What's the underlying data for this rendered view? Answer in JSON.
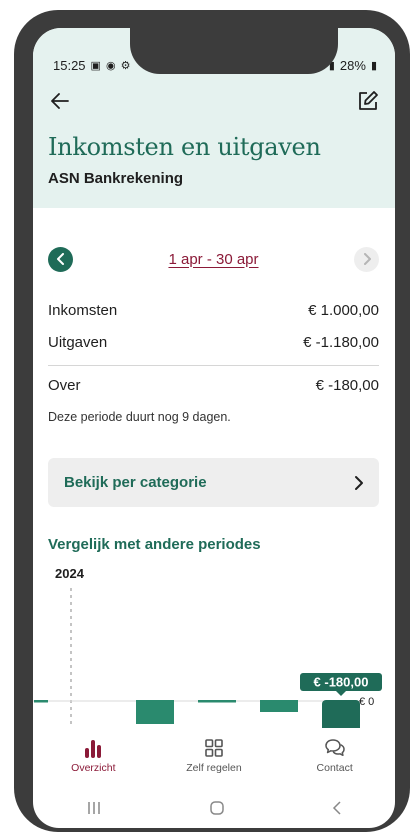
{
  "status_bar": {
    "time": "15:25",
    "battery": "28%"
  },
  "header": {
    "title": "Inkomsten en uitgaven",
    "account": "ASN Bankrekening"
  },
  "period": {
    "label": "1 apr - 30 apr"
  },
  "summary": {
    "income_label": "Inkomsten",
    "income_value": "€ 1.000,00",
    "expenses_label": "Uitgaven",
    "expenses_value": "€ -1.180,00",
    "remaining_label": "Over",
    "remaining_value": "€ -180,00",
    "note": "Deze periode duurt nog 9 dagen."
  },
  "category_button": {
    "label": "Bekijk per categorie"
  },
  "compare": {
    "title": "Vergelijk met andere periodes",
    "year": "2024"
  },
  "chart_data": {
    "type": "bar",
    "categories": [
      "",
      "",
      "",
      "",
      ""
    ],
    "values": [
      0,
      -80,
      0,
      -40,
      -180
    ],
    "highlight_index": 4,
    "highlight_label": "€ -180,00",
    "zero_label": "€ 0",
    "colors": {
      "bar": "#2a8a6e",
      "selected": "#1f6b58"
    }
  },
  "bottom_nav": {
    "items": [
      {
        "label": "Overzicht",
        "icon": "bar-chart-icon",
        "active": true
      },
      {
        "label": "Zelf regelen",
        "icon": "grid-icon",
        "active": false
      },
      {
        "label": "Contact",
        "icon": "chat-icon",
        "active": false
      }
    ]
  },
  "colors": {
    "brand_green": "#1f6b58",
    "accent_red": "#8b1a38",
    "header_bg": "#e5f2ef"
  }
}
